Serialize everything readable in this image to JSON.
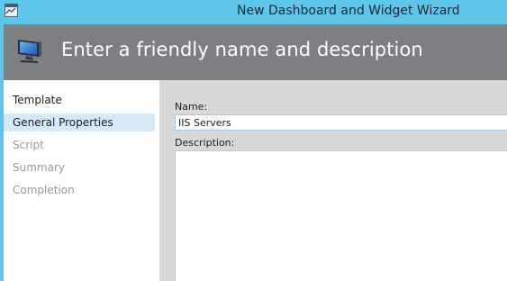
{
  "window": {
    "title": "New Dashboard and Widget Wizard",
    "app_icon": "window-app-icon"
  },
  "header": {
    "title": "Enter a friendly name and description",
    "icon": "monitor-icon"
  },
  "nav": {
    "items": [
      {
        "label": "Template",
        "state": "done"
      },
      {
        "label": "General Properties",
        "state": "active"
      },
      {
        "label": "Script",
        "state": "pending"
      },
      {
        "label": "Summary",
        "state": "pending"
      },
      {
        "label": "Completion",
        "state": "pending"
      }
    ]
  },
  "form": {
    "name_label": "Name:",
    "name_value": "IIS Servers",
    "description_label": "Description:",
    "description_value": ""
  },
  "colors": {
    "titlebar": "#5ec6ea",
    "header": "#7d7f83",
    "nav_active": "#d6e9f8",
    "content_bg": "#d8d8d8"
  }
}
